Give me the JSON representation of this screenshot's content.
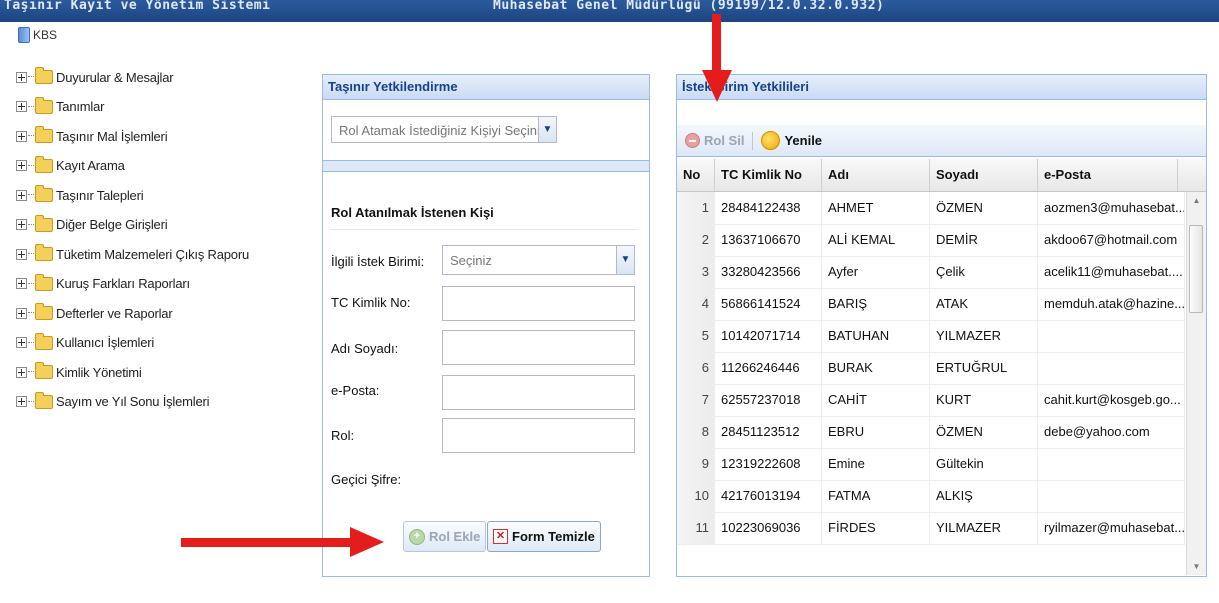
{
  "header": {
    "app_title": "Taşınır Kayıt ve Yönetim Sistemi",
    "unit_info": "Muhasebat Genel Müdürlüğü (99199/12.0.32.0.932)"
  },
  "tree": {
    "root_label": "KBS",
    "items": [
      "Duyurular & Mesajlar",
      "Tanımlar",
      "Taşınır Mal İşlemleri",
      "Kayıt Arama",
      "Taşınır Talepleri",
      "Diğer Belge Girişleri",
      "Tüketim Malzemeleri Çıkış Raporu",
      "Kuruş Farkları Raporları",
      "Defterler ve Raporlar",
      "Kullanıcı İşlemleri",
      "Kimlik Yönetimi",
      "Sayım ve Yıl Sonu İşlemleri"
    ]
  },
  "left_panel": {
    "title": "Taşınır Yetkilendirme",
    "person_select_placeholder": "Rol Atamak İstediğiniz Kişiyi Seçiniz..",
    "form_title": "Rol Atanılmak İstenen Kişi",
    "labels": {
      "birim": "İlgili İstek Birimi:",
      "tc": "TC Kimlik No:",
      "adsoyad": "Adı Soyadı:",
      "eposta": "e-Posta:",
      "rol": "Rol:",
      "sifre": "Geçici Şifre:"
    },
    "birim_value": "Seçiniz",
    "add_role_label": "Rol Ekle",
    "clear_form_label": "Form Temizle"
  },
  "right_panel": {
    "title": "İstek Birim Yetkilileri",
    "remove_role_label": "Rol Sil",
    "refresh_label": "Yenile",
    "columns": [
      "No",
      "TC Kimlik No",
      "Adı",
      "Soyadı",
      "e-Posta"
    ],
    "rows": [
      [
        "1",
        "28484122438",
        "AHMET",
        "ÖZMEN",
        "aozmen3@muhasebat..."
      ],
      [
        "2",
        "13637106670",
        "ALİ KEMAL",
        "DEMİR",
        "akdoo67@hotmail.com"
      ],
      [
        "3",
        "33280423566",
        "Ayfer",
        "Çelik",
        "acelik11@muhasebat...."
      ],
      [
        "4",
        "56866141524",
        "BARIŞ",
        "ATAK",
        "memduh.atak@hazine...."
      ],
      [
        "5",
        "10142071714",
        "BATUHAN",
        "YILMAZER",
        ""
      ],
      [
        "6",
        "11266246446",
        "BURAK",
        "ERTUĞRUL",
        ""
      ],
      [
        "7",
        "62557237018",
        "CAHİT",
        "KURT",
        "cahit.kurt@kosgeb.go..."
      ],
      [
        "8",
        "28451123512",
        "EBRU",
        "ÖZMEN",
        "debe@yahoo.com"
      ],
      [
        "9",
        "12319222608",
        "Emine",
        "Gültekin",
        ""
      ],
      [
        "10",
        "42176013194",
        "FATMA",
        "ALKIŞ",
        ""
      ],
      [
        "11",
        "10223069036",
        "FİRDES",
        "YILMAZER",
        "ryilmazer@muhasebat..."
      ]
    ]
  },
  "colors": {
    "header_bg": "#1d4580",
    "panel_title": "#15428b",
    "panel_border": "#99bbe8",
    "annotation_arrow": "#e41c1c"
  }
}
